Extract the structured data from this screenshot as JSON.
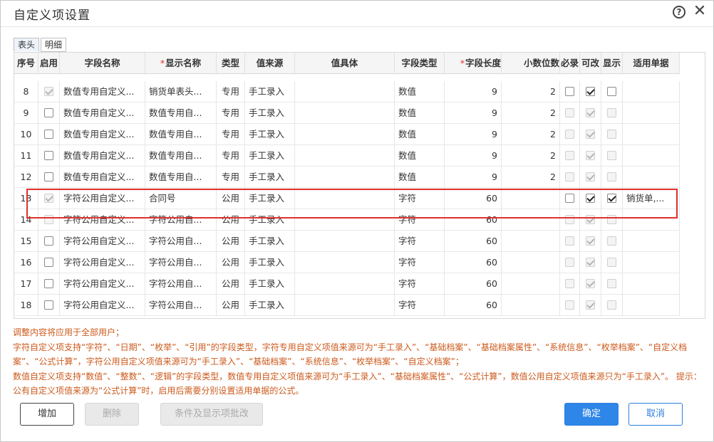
{
  "dialog": {
    "title": "自定义项设置",
    "help_icon": "?",
    "close_icon": "✕"
  },
  "tabs": [
    {
      "label": "表头",
      "active": true
    },
    {
      "label": "明细",
      "active": false
    }
  ],
  "table": {
    "columns": [
      {
        "label": "序号",
        "required": false
      },
      {
        "label": "启用",
        "required": false
      },
      {
        "label": "字段名称",
        "required": false
      },
      {
        "label": "显示名称",
        "required": true
      },
      {
        "label": "类型",
        "required": false
      },
      {
        "label": "值来源",
        "required": false
      },
      {
        "label": "值具体",
        "required": false
      },
      {
        "label": "字段类型",
        "required": false
      },
      {
        "label": "字段长度",
        "required": true
      },
      {
        "label": "小数位数",
        "required": false
      },
      {
        "label": "必录",
        "required": false
      },
      {
        "label": "可改",
        "required": false
      },
      {
        "label": "显示",
        "required": false
      },
      {
        "label": "适用单据",
        "required": false
      }
    ],
    "rows": [
      {
        "no": "8",
        "enabled": true,
        "enabled_disabled": true,
        "field_name": "数值专用自定义...",
        "display_name": "销货单表头...",
        "type": "专用",
        "source": "手工录入",
        "value_detail": "",
        "field_type": "数值",
        "length": "9",
        "decimals": "2",
        "must": false,
        "must_disabled": false,
        "editable": true,
        "editable_disabled": false,
        "show": false,
        "show_disabled": false,
        "docs": ""
      },
      {
        "no": "9",
        "enabled": false,
        "enabled_disabled": false,
        "field_name": "数值专用自定义...",
        "display_name": "数值专用自...",
        "type": "专用",
        "source": "手工录入",
        "value_detail": "",
        "field_type": "数值",
        "length": "9",
        "decimals": "2",
        "must": false,
        "must_disabled": true,
        "editable": true,
        "editable_disabled": true,
        "show": false,
        "show_disabled": true,
        "docs": ""
      },
      {
        "no": "10",
        "enabled": false,
        "enabled_disabled": false,
        "field_name": "数值专用自定义...",
        "display_name": "数值专用自...",
        "type": "专用",
        "source": "手工录入",
        "value_detail": "",
        "field_type": "数值",
        "length": "9",
        "decimals": "2",
        "must": false,
        "must_disabled": true,
        "editable": true,
        "editable_disabled": true,
        "show": false,
        "show_disabled": true,
        "docs": ""
      },
      {
        "no": "11",
        "enabled": false,
        "enabled_disabled": false,
        "field_name": "数值专用自定义...",
        "display_name": "数值专用自...",
        "type": "专用",
        "source": "手工录入",
        "value_detail": "",
        "field_type": "数值",
        "length": "9",
        "decimals": "2",
        "must": false,
        "must_disabled": true,
        "editable": true,
        "editable_disabled": true,
        "show": false,
        "show_disabled": true,
        "docs": ""
      },
      {
        "no": "12",
        "enabled": false,
        "enabled_disabled": false,
        "field_name": "数值专用自定义...",
        "display_name": "数值专用自...",
        "type": "专用",
        "source": "手工录入",
        "value_detail": "",
        "field_type": "数值",
        "length": "9",
        "decimals": "2",
        "must": false,
        "must_disabled": true,
        "editable": true,
        "editable_disabled": true,
        "show": false,
        "show_disabled": true,
        "docs": ""
      },
      {
        "no": "13",
        "enabled": true,
        "enabled_disabled": true,
        "field_name": "字符公用自定义...",
        "display_name": "合同号",
        "type": "公用",
        "source": "手工录入",
        "value_detail": "",
        "field_type": "字符",
        "length": "60",
        "decimals": "",
        "must": false,
        "must_disabled": false,
        "editable": true,
        "editable_disabled": false,
        "show": true,
        "show_disabled": false,
        "docs": "销货单,..."
      },
      {
        "no": "14",
        "enabled": false,
        "enabled_disabled": true,
        "field_name": "字符公用自定义...",
        "display_name": "字符公用自...",
        "type": "公用",
        "source": "手工录入",
        "value_detail": "",
        "field_type": "字符",
        "length": "60",
        "decimals": "",
        "must": false,
        "must_disabled": true,
        "editable": true,
        "editable_disabled": true,
        "show": false,
        "show_disabled": true,
        "docs": ""
      },
      {
        "no": "15",
        "enabled": false,
        "enabled_disabled": false,
        "field_name": "字符公用自定义...",
        "display_name": "字符公用自...",
        "type": "公用",
        "source": "手工录入",
        "value_detail": "",
        "field_type": "字符",
        "length": "60",
        "decimals": "",
        "must": false,
        "must_disabled": true,
        "editable": true,
        "editable_disabled": true,
        "show": false,
        "show_disabled": true,
        "docs": ""
      },
      {
        "no": "16",
        "enabled": false,
        "enabled_disabled": false,
        "field_name": "字符公用自定义...",
        "display_name": "字符公用自...",
        "type": "公用",
        "source": "手工录入",
        "value_detail": "",
        "field_type": "字符",
        "length": "60",
        "decimals": "",
        "must": false,
        "must_disabled": true,
        "editable": true,
        "editable_disabled": true,
        "show": false,
        "show_disabled": true,
        "docs": ""
      },
      {
        "no": "17",
        "enabled": false,
        "enabled_disabled": false,
        "field_name": "字符公用自定义...",
        "display_name": "字符公用自...",
        "type": "公用",
        "source": "手工录入",
        "value_detail": "",
        "field_type": "字符",
        "length": "60",
        "decimals": "",
        "must": false,
        "must_disabled": true,
        "editable": true,
        "editable_disabled": true,
        "show": false,
        "show_disabled": true,
        "docs": ""
      },
      {
        "no": "18",
        "enabled": false,
        "enabled_disabled": false,
        "field_name": "字符公用自定义...",
        "display_name": "字符公用自...",
        "type": "公用",
        "source": "手工录入",
        "value_detail": "",
        "field_type": "字符",
        "length": "60",
        "decimals": "",
        "must": false,
        "must_disabled": true,
        "editable": true,
        "editable_disabled": true,
        "show": false,
        "show_disabled": true,
        "docs": ""
      }
    ]
  },
  "scrollbar": {
    "up": "▲",
    "down": "▼"
  },
  "notes": [
    "调整内容将应用于全部用户；",
    "字符自定义项支持“字符”、“日期”、“枚举”、“引用”的字段类型，字符专用自定义项值来源可为“手工录入”、“基础档案”、“基础档案属性”、“系统信息”、“枚举档案”、“自定义档案”、“公式计算”，字符公用自定义项值来源可为“手工录入”、“基础档案”、“系统信息”、“枚举档案”、“自定义档案”；",
    "数值自定义项支持“数值”、“整数”、“逻辑”的字段类型，数值专用自定义项值来源可为“手工录入”、“基础档案属性”、“公式计算”，数值公用自定义项值来源只为“手工录入”。 提示：公有自定义项值来源为“公式计算”时，启用后需要分别设置适用单据的公式。"
  ],
  "buttons": {
    "add": "增加",
    "delete": "删除",
    "batch": "条件及显示项批改",
    "ok": "确定",
    "cancel": "取消"
  },
  "colors": {
    "primary": "#2d86e8",
    "note_text": "#cc5a1c",
    "highlight_border": "#e0302d"
  }
}
